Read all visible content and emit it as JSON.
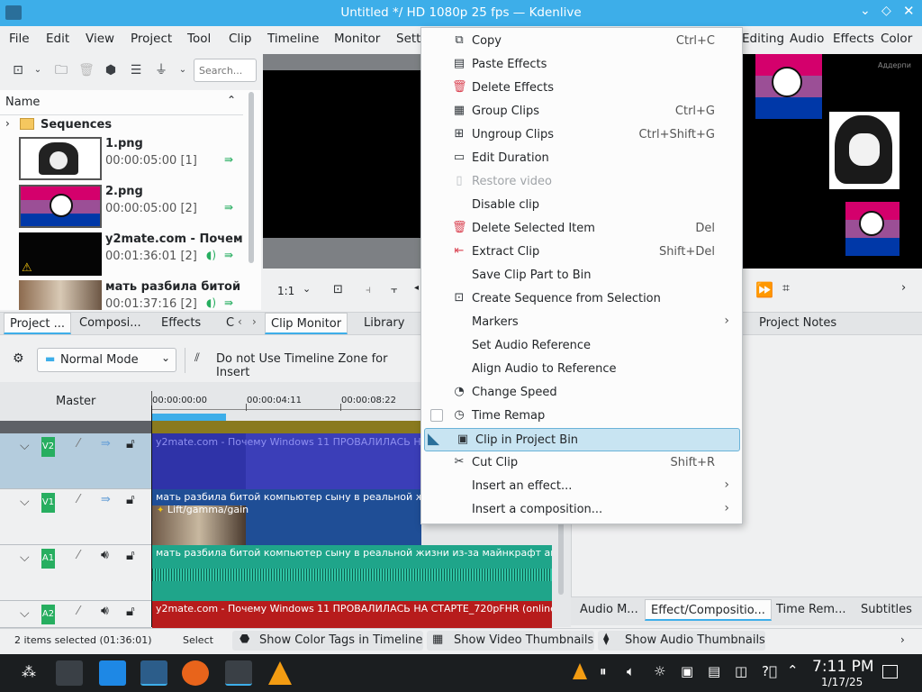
{
  "window": {
    "title": "Untitled */ HD 1080p 25 fps — Kdenlive"
  },
  "menubar": {
    "left": [
      "File",
      "Edit",
      "View",
      "Project",
      "Tool",
      "Clip",
      "Timeline",
      "Monitor",
      "Setti"
    ],
    "right": [
      "Editing",
      "Audio",
      "Effects",
      "Color"
    ]
  },
  "bin": {
    "search_placeholder": "Search...",
    "column_name": "Name",
    "folder": "Sequences",
    "items": [
      {
        "name": "1.png",
        "duration": "00:00:05:00 [1]"
      },
      {
        "name": "2.png",
        "duration": "00:00:05:00 [2]"
      },
      {
        "name": "y2mate.com - Почему W",
        "duration": "00:01:36:01 [2]"
      },
      {
        "name": "мать разбила битой ко",
        "duration": "00:01:37:16 [2]"
      }
    ]
  },
  "dock_tabs": {
    "left": [
      "Project ...",
      "Composi...",
      "Effects",
      "C"
    ],
    "monitor": [
      "Clip Monitor",
      "Library"
    ],
    "right": "Project Notes"
  },
  "monitor": {
    "zoom": "1:1"
  },
  "timeline": {
    "mode": "Normal Mode",
    "zone": "Do not Use Timeline Zone for Insert",
    "master": "Master",
    "ruler": [
      "00:00:00:00",
      "00:00:04:11",
      "00:00:08:22"
    ],
    "tracks": [
      {
        "id": "V2",
        "clip": "y2mate.com - Почему Windows 11 ПРОВАЛИЛАСЬ НА СТ"
      },
      {
        "id": "V1",
        "clip": "мать разбила битой компьютер сыну в реальной жизни",
        "effect": "Lift/gamma/gain"
      },
      {
        "id": "A1",
        "clip": "мать разбила битой компьютер сыну в реальной жизни из-за майнкрафт анти-гри"
      },
      {
        "id": "A2",
        "clip": "y2mate.com - Почему Windows 11 ПРОВАЛИЛАСЬ НА СТАРТЕ_720pFHR (online-video"
      }
    ]
  },
  "bottom_tabs": [
    "Audio M...",
    "Effect/Compositio...",
    "Time Rem...",
    "Subtitles"
  ],
  "status": {
    "selection": "2 items selected (01:36:01)",
    "tool": "Select",
    "color_tags": "Show Color Tags in Timeline",
    "video_thumbs": "Show Video Thumbnails",
    "audio_thumbs": "Show Audio Thumbnails"
  },
  "context_menu": [
    {
      "label": "Copy",
      "shortcut": "Ctrl+C",
      "icon": "copy-icon"
    },
    {
      "label": "Paste Effects",
      "shortcut": "",
      "icon": "paste-icon"
    },
    {
      "label": "Delete Effects",
      "shortcut": "",
      "icon": "trash-icon"
    },
    {
      "label": "Group Clips",
      "shortcut": "Ctrl+G",
      "icon": "group-icon"
    },
    {
      "label": "Ungroup Clips",
      "shortcut": "Ctrl+Shift+G",
      "icon": "ungroup-icon"
    },
    {
      "label": "Edit Duration",
      "shortcut": "",
      "icon": "duration-icon"
    },
    {
      "label": "Restore video",
      "shortcut": "",
      "icon": "restore-icon",
      "disabled": true
    },
    {
      "label": "Disable clip",
      "shortcut": "",
      "icon": ""
    },
    {
      "label": "Delete Selected Item",
      "shortcut": "Del",
      "icon": "trash-icon"
    },
    {
      "label": "Extract Clip",
      "shortcut": "Shift+Del",
      "icon": "extract-icon"
    },
    {
      "label": "Save Clip Part to Bin",
      "shortcut": "",
      "icon": ""
    },
    {
      "label": "Create Sequence from Selection",
      "shortcut": "",
      "icon": "sequence-icon"
    },
    {
      "label": "Markers",
      "shortcut": "",
      "icon": "",
      "submenu": true
    },
    {
      "label": "Set Audio Reference",
      "shortcut": "",
      "icon": ""
    },
    {
      "label": "Align Audio to Reference",
      "shortcut": "",
      "icon": ""
    },
    {
      "label": "Change Speed",
      "shortcut": "",
      "icon": "speed-icon"
    },
    {
      "label": "Time Remap",
      "shortcut": "",
      "icon": "time-remap-icon",
      "checkbox": true
    },
    {
      "label": "Clip in Project Bin",
      "shortcut": "",
      "icon": "bin-icon",
      "highlighted": true
    },
    {
      "label": "Cut Clip",
      "shortcut": "Shift+R",
      "icon": "cut-icon"
    },
    {
      "label": "Insert an effect...",
      "shortcut": "",
      "icon": "",
      "submenu": true
    },
    {
      "label": "Insert a composition...",
      "shortcut": "",
      "icon": "",
      "submenu": true
    }
  ],
  "clock": {
    "time": "7:11 PM",
    "date": "1/17/25"
  },
  "preview": {
    "watermark": "Аддерпи"
  }
}
